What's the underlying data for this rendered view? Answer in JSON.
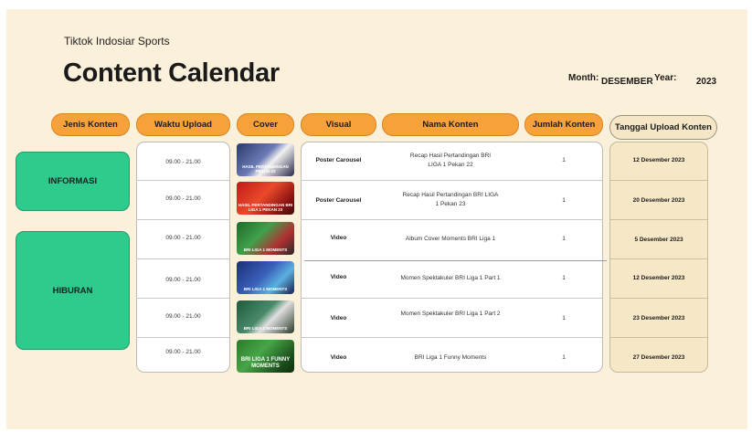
{
  "header": {
    "subtitle": "Tiktok Indosiar Sports",
    "title": "Content Calendar",
    "month_label": "Month:",
    "month_value": "DESEMBER",
    "year_label": "Year:",
    "year_value": "2023"
  },
  "columns": [
    "Jenis Konten",
    "Waktu Upload",
    "Cover",
    "Visual",
    "Nama Konten",
    "Jumlah Konten",
    "Tanggal Upload Konten"
  ],
  "categories": [
    "INFORMASI",
    "HIBURAN"
  ],
  "rows": [
    {
      "time": "09.00 - 21.00",
      "cover": "HASIL PERTANDINGAN PEKAN 22",
      "visual": "Poster Carousel",
      "name_1": "Recap Hasil Pertandingan BRI",
      "name_2": "LIGA 1 Pekan 22",
      "count": "1",
      "date": "12 Desember 2023"
    },
    {
      "time": "09.00 - 21.00",
      "cover": "HASIL PERTANDINGAN BRI LIGA 1 PEKAN 23",
      "visual": "Poster Carousel",
      "name_1": "Recap Hasil Pertandingan BRI LIGA",
      "name_2": "1 Pekan 23",
      "count": "1",
      "date": "20 Desember 2023"
    },
    {
      "time": "09.00 - 21.00",
      "cover": "BRI LIGA 1 MOMENTS",
      "visual": "Video",
      "name_1": "Album Cover Moments BRI Liga 1",
      "name_2": "",
      "count": "1",
      "date": "5 Desember 2023"
    },
    {
      "time": "09.00 - 21.00",
      "cover": "BRI LIGA 1 MOMENTS",
      "visual": "Video",
      "name_1": "Momen Spektakuler BRI Liga 1 Part 1",
      "name_2": "",
      "count": "1",
      "date": "12 Desember 2023"
    },
    {
      "time": "09.00 - 21.00",
      "cover": "BRI LIGA 1 MOMENTS",
      "visual": "Video",
      "name_1": "Momen Spektakuler BRI Liga 1 Part 2",
      "name_2": "",
      "count": "1",
      "date": "23 Desember 2023"
    },
    {
      "time": "09.00 - 21.00",
      "cover": "BRI LIGA 1 FUNNY MOMENTS",
      "visual": "Video",
      "name_1": "BRI Liga 1 Funny Moments",
      "name_2": "",
      "count": "1",
      "date": "27 Desember 2023"
    }
  ]
}
